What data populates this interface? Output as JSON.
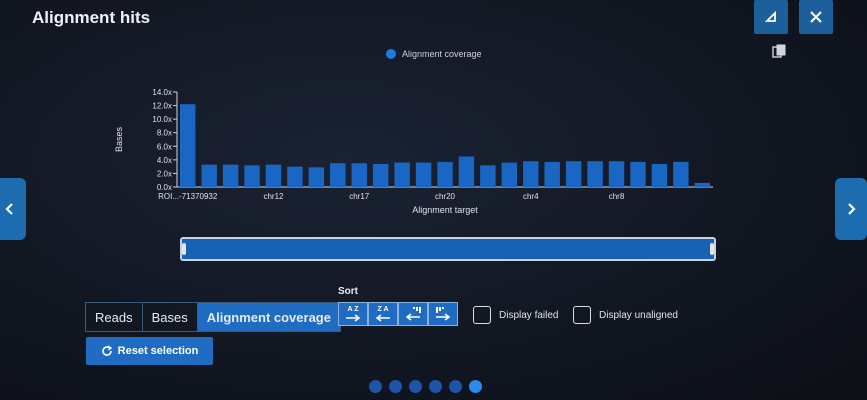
{
  "header": {
    "title": "Alignment hits",
    "collapse_icon": "collapse-icon",
    "close_icon": "close-icon",
    "copy_icon": "copy-icon"
  },
  "nav": {
    "prev_icon": "chevron-left-icon",
    "next_icon": "chevron-right-icon"
  },
  "view_tabs": [
    {
      "label": "Reads",
      "active": false
    },
    {
      "label": "Bases",
      "active": false
    },
    {
      "label": "Alignment coverage",
      "active": true
    }
  ],
  "sort": {
    "label": "Sort",
    "buttons": [
      {
        "top": "A Z",
        "icon": "sort-az-icon"
      },
      {
        "top": "Z A",
        "icon": "sort-za-icon"
      },
      {
        "top": "",
        "icon": "sort-desc-icon"
      },
      {
        "top": "",
        "icon": "sort-asc-icon"
      }
    ]
  },
  "options": {
    "display_failed": "Display failed",
    "display_unaligned": "Display unaligned"
  },
  "reset_label": "Reset selection",
  "pager": {
    "pages": 6,
    "current": 6
  },
  "colors": {
    "bar": "#1a66c4",
    "accent": "#1f6cc2",
    "background": "#121722"
  },
  "chart_data": {
    "type": "bar",
    "legend": "Alignment coverage",
    "xlabel": "Alignment target",
    "ylabel": "Bases",
    "ylim": [
      0,
      14
    ],
    "yticks": [
      "0.0x",
      "2.0x",
      "4.0x",
      "6.0x",
      "8.0x",
      "10.0x",
      "12.0x",
      "14.0x"
    ],
    "xticklabels": [
      {
        "index": 0,
        "label": "ROI...-71370932"
      },
      {
        "index": 4,
        "label": "chr12"
      },
      {
        "index": 8,
        "label": "chr17"
      },
      {
        "index": 12,
        "label": "chr20"
      },
      {
        "index": 16,
        "label": "chr4"
      },
      {
        "index": 20,
        "label": "chr8"
      }
    ],
    "values": [
      12.2,
      3.3,
      3.3,
      3.2,
      3.3,
      3.0,
      2.9,
      3.5,
      3.5,
      3.4,
      3.6,
      3.6,
      3.7,
      4.5,
      3.2,
      3.6,
      3.8,
      3.7,
      3.8,
      3.8,
      3.8,
      3.7,
      3.4,
      3.7,
      0.6
    ]
  }
}
